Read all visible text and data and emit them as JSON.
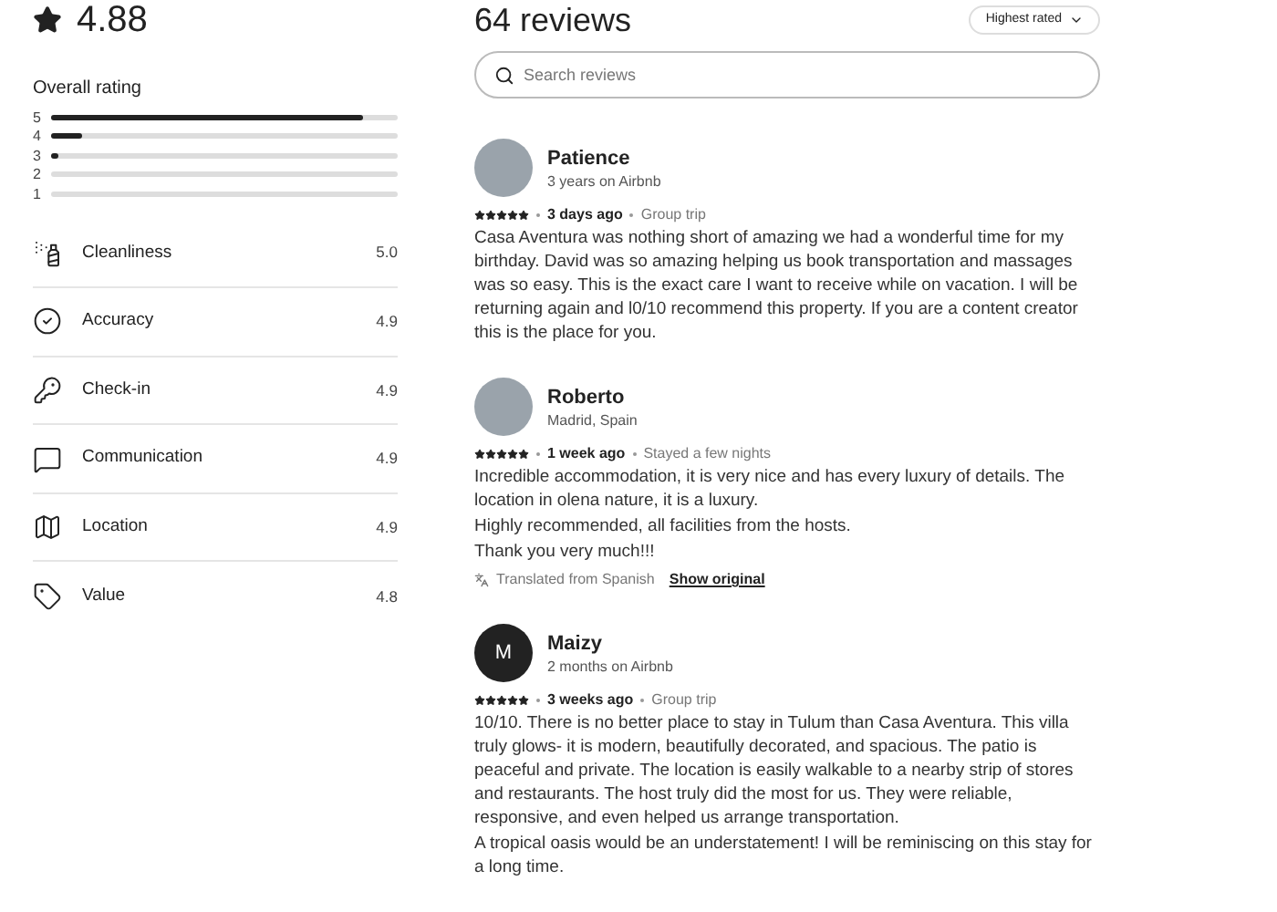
{
  "summary": {
    "score": "4.88",
    "overall_label": "Overall rating",
    "distribution": [
      {
        "label": "5",
        "level": 0.9
      },
      {
        "label": "4",
        "level": 0.09
      },
      {
        "label": "3",
        "level": 0.02
      },
      {
        "label": "2",
        "level": 0
      },
      {
        "label": "1",
        "level": 0
      }
    ],
    "categories": [
      {
        "kind": "spray",
        "label": "Cleanliness",
        "score": "5.0"
      },
      {
        "kind": "check",
        "label": "Accuracy",
        "score": "4.9"
      },
      {
        "kind": "key",
        "label": "Check-in",
        "score": "4.9"
      },
      {
        "kind": "chat",
        "label": "Communication",
        "score": "4.9"
      },
      {
        "kind": "map",
        "label": "Location",
        "score": "4.9"
      },
      {
        "kind": "tag",
        "label": "Value",
        "score": "4.8"
      }
    ]
  },
  "reviews_header": {
    "count": "64 reviews",
    "sort": "Highest rated"
  },
  "search": {
    "placeholder": "Search reviews"
  },
  "reviews": [
    {
      "name": "Patience",
      "subtitle": "3 years on Airbnb",
      "stars": 5,
      "date": "3 days ago",
      "trip": "Group trip",
      "paragraphs": [
        "Casa Aventura was nothing short of amazing we had a wonderful time for my birthday. David was so amazing helping us book transportation and massages was so easy. This is the exact care I want to receive while on vacation. I will be returning again and l0/10 recommend this property. If you are a content creator this is the place for you."
      ]
    },
    {
      "name": "Roberto",
      "subtitle": "Madrid, Spain",
      "stars": 5,
      "date": "1 week ago",
      "trip": "Stayed a few nights",
      "paragraphs": [
        "Incredible accommodation, it is very nice and has every luxury of details. The location in olena nature, it is a luxury.",
        "Highly recommended, all facilities from the hosts.",
        "Thank you very much!!!"
      ],
      "translation": {
        "note": "Translated from Spanish",
        "link": "Show original"
      }
    },
    {
      "name": "Maizy",
      "subtitle": "2 months on Airbnb",
      "initial": "M",
      "stars": 5,
      "date": "3 weeks ago",
      "trip": "Group trip",
      "paragraphs": [
        "10/10. There is no better place to stay in Tulum than Casa Aventura. This villa truly glows- it is modern, beautifully decorated, and spacious. The patio is peaceful and private. The location is easily walkable to a nearby strip of stores and restaurants. The host truly did the most for us. They were reliable, responsive, and even helped us arrange transportation.",
        "A tropical oasis would be an understatement! I will be reminiscing on this stay for a long time."
      ]
    }
  ]
}
